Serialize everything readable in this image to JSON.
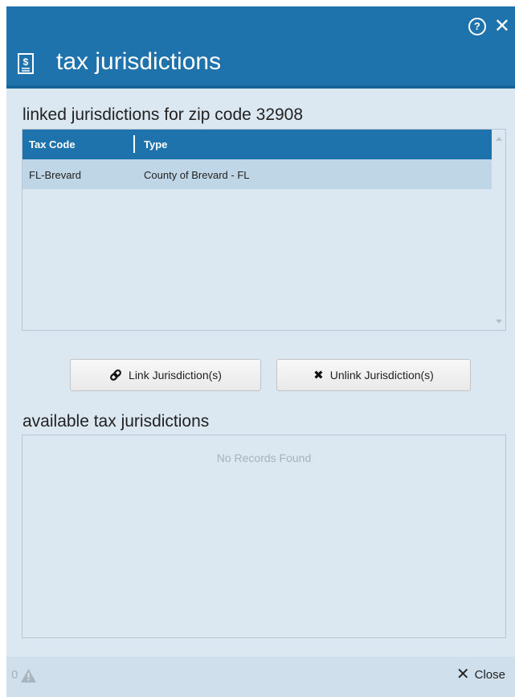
{
  "dialog": {
    "title": "tax jurisdictions",
    "help_icon": "question-circle-icon",
    "close_icon": "close-icon",
    "title_icon": "tax-document-icon"
  },
  "linked": {
    "heading": "linked jurisdictions for zip code 32908",
    "columns": [
      "Tax Code",
      "Type"
    ],
    "rows": [
      {
        "tax_code": "FL-Brevard",
        "type": "County of Brevard - FL"
      }
    ]
  },
  "actions": {
    "link_label": "Link Jurisdiction(s)",
    "link_icon": "link-icon",
    "unlink_label": "Unlink Jurisdiction(s)",
    "unlink_icon": "x-icon"
  },
  "available": {
    "heading": "available tax jurisdictions",
    "empty_message": "No Records Found"
  },
  "footer": {
    "warning_count": "0",
    "warning_icon": "warning-triangle-icon",
    "close_label": "Close"
  },
  "colors": {
    "header_blue": "#1f73ad",
    "panel_bg": "#dbe8f1",
    "selected_row": "#bfd6e6"
  }
}
